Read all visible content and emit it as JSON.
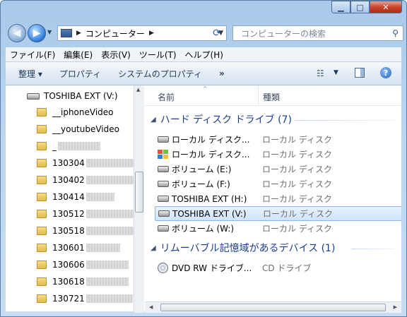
{
  "address": {
    "crumb": "コンピューター"
  },
  "search": {
    "placeholder": "コンピューターの検索"
  },
  "menu": [
    "ファイル(F)",
    "編集(E)",
    "表示(V)",
    "ツール(T)",
    "ヘルプ(H)"
  ],
  "toolbar": {
    "organize": "整理 ▾",
    "properties": "プロパティ",
    "system_properties": "システムのプロパティ",
    "more": "»"
  },
  "tree": {
    "root": "TOSHIBA EXT (V:)",
    "folders": [
      "__iphoneVideo",
      "__youtubeVideo",
      "_",
      "130304",
      "130402",
      "130414",
      "130512",
      "130518",
      "130601",
      "130606",
      "130618",
      "130721"
    ]
  },
  "columns": {
    "name": "名前",
    "type": "種類"
  },
  "groups": [
    {
      "title": "ハード ディスク ドライブ (7)",
      "items": [
        {
          "name": "ローカル ディスク...",
          "type": "ローカル ディスク",
          "icon": "hard-drive-icon"
        },
        {
          "name": "ローカル ディスク...",
          "type": "ローカル ディスク",
          "icon": "windows-drive-icon"
        },
        {
          "name": "ボリューム (E:)",
          "type": "ローカル ディスク",
          "icon": "hard-drive-icon"
        },
        {
          "name": "ボリューム (F:)",
          "type": "ローカル ディスク",
          "icon": "hard-drive-icon"
        },
        {
          "name": "TOSHIBA EXT (H:)",
          "type": "ローカル ディスク",
          "icon": "hard-drive-icon"
        },
        {
          "name": "TOSHIBA EXT (V:)",
          "type": "ローカル ディスク",
          "icon": "hard-drive-icon",
          "selected": true
        },
        {
          "name": "ボリューム (W:)",
          "type": "ローカル ディスク",
          "icon": "hard-drive-icon"
        }
      ]
    },
    {
      "title": "リムーバブル記憶域があるデバイス (1)",
      "items": [
        {
          "name": "DVD RW ドライブ...",
          "type": "CD ドライブ",
          "icon": "dvd-drive-icon"
        }
      ]
    }
  ],
  "colors": {
    "accent": "#1e3f8a",
    "selection": "#cfe4fc"
  }
}
